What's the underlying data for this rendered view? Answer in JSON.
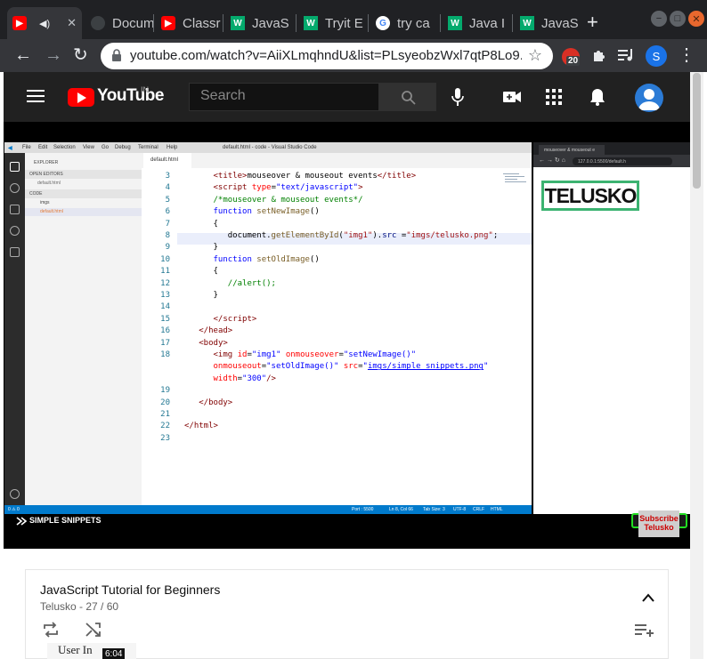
{
  "browser": {
    "tabs": [
      {
        "title": "",
        "favicon": "youtube-icon"
      },
      {
        "title": "Docum",
        "favicon": "docs-icon"
      },
      {
        "title": "Classr",
        "favicon": "youtube-icon"
      },
      {
        "title": "JavaS",
        "favicon": "w3-icon"
      },
      {
        "title": "Tryit E",
        "favicon": "w3-icon"
      },
      {
        "title": "try ca",
        "favicon": "google-icon"
      },
      {
        "title": "Java I",
        "favicon": "w3-icon"
      },
      {
        "title": "JavaS",
        "favicon": "w3-icon"
      }
    ],
    "url": "youtube.com/watch?v=AiiXLmqhndU&list=PLsyeobzWxl7qtP8Lo9...",
    "extension_count": "20",
    "profile_initial": "S"
  },
  "youtube": {
    "logo_text": "YouTube",
    "region": "IN",
    "search_placeholder": "Search"
  },
  "video": {
    "vscode": {
      "title": "default.html - code - Visual Studio Code",
      "menu": [
        "File",
        "Edit",
        "Selection",
        "View",
        "Go",
        "Debug",
        "Terminal",
        "Help"
      ],
      "explorer_label": "EXPLORER",
      "open_editors_label": "OPEN EDITORS",
      "open_file": "default.html",
      "folder_label": "CODE",
      "tree": [
        "imgs",
        "default.html"
      ],
      "tab_label": "default.html",
      "status": {
        "port": "Port : 5500",
        "position": "Ln 8, Col 66",
        "tab_size": "Tab Size: 3",
        "encoding": "UTF-8",
        "eol": "CRLF",
        "language": "HTML",
        "problems": "0 ⚠ 0"
      },
      "line_numbers": [
        "3",
        "4",
        "5",
        "6",
        "7",
        "8",
        "9",
        "10",
        "11",
        "12",
        "13",
        "14",
        "15",
        "16",
        "17",
        "18",
        "",
        "",
        "19",
        "20",
        "21",
        "22",
        "23"
      ]
    },
    "preview": {
      "tab_title": "mouseover & mouseout e",
      "url": "127.0.0.1:5500/default.h",
      "logo_text": "TELUSKO"
    },
    "channel_brand": "SIMPLE SNIPPETS",
    "subscribe_text": "Subscribe Telusko"
  },
  "playlist": {
    "title": "JavaScript Tutorial for Beginners",
    "subtitle": "Telusko - 27 / 60",
    "next_item_text": "User In",
    "next_item_duration": "6:04"
  }
}
